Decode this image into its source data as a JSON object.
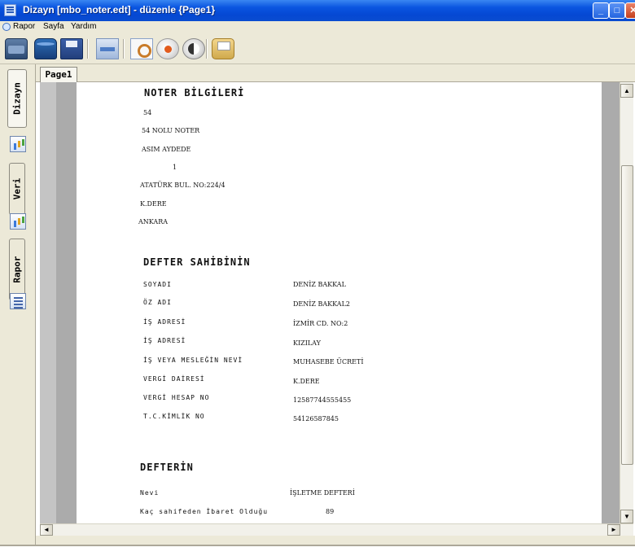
{
  "window": {
    "title": "Dizayn  [mbo_noter.edt] - düzenle {Page1}",
    "controls": {
      "minimize": "_",
      "maximize": "□",
      "close": "✕"
    }
  },
  "menu": {
    "items": [
      "Rapor",
      "Sayfa",
      "Yardım"
    ]
  },
  "toolbar": {
    "buttons": [
      "database-icon",
      "database-connect-icon",
      "save-icon",
      "page-setup-icon",
      "preview-icon",
      "stop-icon",
      "close-icon",
      "print-icon"
    ]
  },
  "side_tabs": {
    "dizayn": "Dizayn",
    "veri": "Veri",
    "rapor": "Rapor"
  },
  "page_tab": "Page1",
  "report": {
    "noter_heading": "NOTER BİLGİLERİ",
    "noter_lines": [
      "54",
      "54 NOLU NOTER",
      "ASIM AYDEDE",
      "1",
      "ATATÜRK BUL. NO:224/4",
      "K.DERE",
      "ANKARA"
    ],
    "owner_heading": "DEFTER SAHİBİNİN",
    "owner_fields": [
      {
        "label": "SOYADI",
        "value": "DENİZ BAKKAL"
      },
      {
        "label": "ÖZ ADI",
        "value": "DENİZ BAKKAL2"
      },
      {
        "label": "İŞ ADRESİ",
        "value": "İZMİR CD. NO:2"
      },
      {
        "label": "İŞ ADRESİ",
        "value": "KIZILAY"
      },
      {
        "label": "İŞ VEYA MESLEĞİN NEVİ",
        "value": "MUHASEBE ÜCRETİ"
      },
      {
        "label": "VERGİ DAİRESİ",
        "value": "K.DERE"
      },
      {
        "label": "VERGİ HESAP NO",
        "value": "12587744555455"
      },
      {
        "label": "T.C.KİMLİK NO",
        "value": "54126587845"
      }
    ],
    "book_heading": "DEFTERİN",
    "book_fields": [
      {
        "label": "Nevi",
        "value": "İŞLETME DEFTERİ"
      },
      {
        "label": "Kaç sahifeden İbaret Olduğu",
        "value": "89"
      }
    ]
  },
  "scroll": {
    "up": "▲",
    "down": "▼",
    "left": "◄",
    "right": "►"
  }
}
